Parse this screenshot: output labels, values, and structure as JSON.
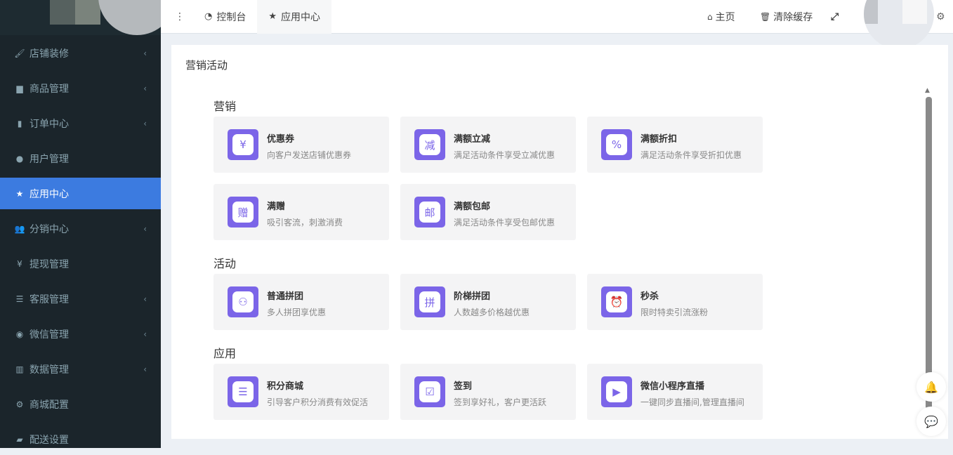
{
  "sidebar": {
    "items": [
      {
        "label": "店铺装修",
        "icon": "brush-icon",
        "glyph": "🖌",
        "arrow": true
      },
      {
        "label": "商品管理",
        "icon": "archive-icon",
        "glyph": "▆",
        "arrow": true
      },
      {
        "label": "订单中心",
        "icon": "file-icon",
        "glyph": "▮",
        "arrow": true
      },
      {
        "label": "用户管理",
        "icon": "user-icon",
        "glyph": "●",
        "arrow": false
      },
      {
        "label": "应用中心",
        "icon": "star-icon",
        "glyph": "★",
        "arrow": false,
        "active": true
      },
      {
        "label": "分销中心",
        "icon": "users-icon",
        "glyph": "👥",
        "arrow": true
      },
      {
        "label": "提现管理",
        "icon": "yen-icon",
        "glyph": "¥",
        "arrow": false
      },
      {
        "label": "客服管理",
        "icon": "list-icon",
        "glyph": "☰",
        "arrow": true
      },
      {
        "label": "微信管理",
        "icon": "wechat-icon",
        "glyph": "◉",
        "arrow": true
      },
      {
        "label": "数据管理",
        "icon": "bar-chart-icon",
        "glyph": "▥",
        "arrow": true
      },
      {
        "label": "商城配置",
        "icon": "gears-icon",
        "glyph": "⚙",
        "arrow": false
      },
      {
        "label": "配送设置",
        "icon": "car-icon",
        "glyph": "▰",
        "arrow": false
      }
    ]
  },
  "header": {
    "tabs": [
      {
        "label": "控制台",
        "glyph": "◔"
      },
      {
        "label": "应用中心",
        "glyph": "★"
      }
    ],
    "home": "主页",
    "clear_cache": "清除缓存"
  },
  "main": {
    "title": "营销活动",
    "sections": [
      {
        "label": "营销",
        "items": [
          {
            "title": "优惠券",
            "desc": "向客户发送店铺优惠券",
            "glyph": "¥"
          },
          {
            "title": "满额立减",
            "desc": "满足活动条件享受立减优惠",
            "glyph": "减"
          },
          {
            "title": "满额折扣",
            "desc": "满足活动条件享受折扣优惠",
            "glyph": "%"
          },
          {
            "title": "满赠",
            "desc": "吸引客流，刺激消费",
            "glyph": "赠"
          },
          {
            "title": "满额包邮",
            "desc": "满足活动条件享受包邮优惠",
            "glyph": "邮"
          }
        ]
      },
      {
        "label": "活动",
        "items": [
          {
            "title": "普通拼团",
            "desc": "多人拼团享优惠",
            "glyph": "⚇"
          },
          {
            "title": "阶梯拼团",
            "desc": "人数越多价格越优惠",
            "glyph": "拼"
          },
          {
            "title": "秒杀",
            "desc": "限时特卖引流涨粉",
            "glyph": "⏰"
          }
        ]
      },
      {
        "label": "应用",
        "items": [
          {
            "title": "积分商城",
            "desc": "引导客户积分消费有效促活",
            "glyph": "☰"
          },
          {
            "title": "签到",
            "desc": "签到享好礼，客户更活跃",
            "glyph": "☑"
          },
          {
            "title": "微信小程序直播",
            "desc": "一键同步直播间,管理直播间",
            "glyph": "▶"
          }
        ]
      }
    ]
  },
  "colors": {
    "accent": "#3c7be0",
    "purple": "#7b65e8",
    "sidebar": "#1b252b"
  }
}
